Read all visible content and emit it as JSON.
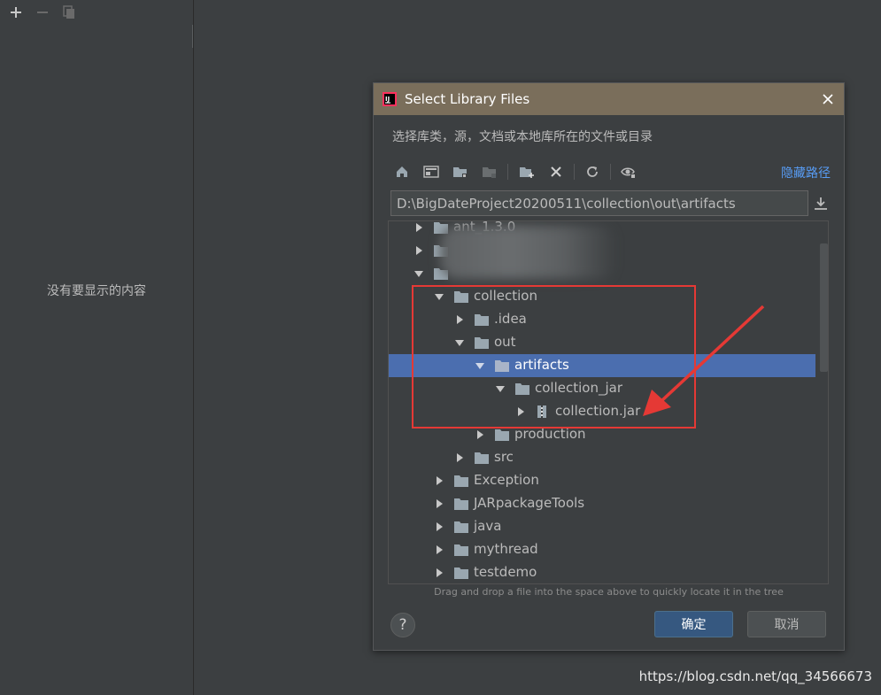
{
  "left_panel": {
    "toolbar": [
      {
        "name": "add-icon",
        "glyph": "+"
      },
      {
        "name": "remove-icon",
        "glyph": "−"
      },
      {
        "name": "copy-icon",
        "glyph": ""
      }
    ],
    "empty_text": "没有要显示的内容"
  },
  "dialog": {
    "title": "Select Library Files",
    "description": "选择库类，源，文档或本地库所在的文件或目录",
    "hide_path_link": "隐藏路径",
    "path_value": "D:\\BigDateProject20200511\\collection\\out\\artifacts",
    "hint": "Drag and drop a file into the space above to quickly locate it in the tree",
    "ok_label": "确定",
    "cancel_label": "取消",
    "help_label": "?",
    "toolbar_icons": [
      "home-icon",
      "desktop-icon",
      "project-folder-icon",
      "module-folder-icon",
      "new-folder-icon",
      "delete-icon",
      "refresh-icon",
      "show-hidden-icon"
    ]
  },
  "tree": {
    "rows": [
      {
        "label": "ant_1.3.0",
        "depth": 1,
        "expanded": false,
        "type": "folder"
      },
      {
        "label": "",
        "depth": 1,
        "expanded": false,
        "type": "folder"
      },
      {
        "label": "",
        "depth": 1,
        "expanded": true,
        "type": "folder"
      },
      {
        "label": "collection",
        "depth": 2,
        "expanded": true,
        "type": "folder"
      },
      {
        "label": ".idea",
        "depth": 3,
        "expanded": false,
        "type": "folder"
      },
      {
        "label": "out",
        "depth": 3,
        "expanded": true,
        "type": "folder"
      },
      {
        "label": "artifacts",
        "depth": 4,
        "expanded": true,
        "type": "folder",
        "selected": true
      },
      {
        "label": "collection_jar",
        "depth": 5,
        "expanded": true,
        "type": "folder"
      },
      {
        "label": "collection.jar",
        "depth": 6,
        "expanded": false,
        "type": "jar"
      },
      {
        "label": "production",
        "depth": 4,
        "expanded": false,
        "type": "folder"
      },
      {
        "label": "src",
        "depth": 3,
        "expanded": false,
        "type": "folder"
      },
      {
        "label": "Exception",
        "depth": 2,
        "expanded": false,
        "type": "folder"
      },
      {
        "label": "JARpackageTools",
        "depth": 2,
        "expanded": false,
        "type": "folder"
      },
      {
        "label": "java",
        "depth": 2,
        "expanded": false,
        "type": "folder"
      },
      {
        "label": "mythread",
        "depth": 2,
        "expanded": false,
        "type": "folder"
      },
      {
        "label": "testdemo",
        "depth": 2,
        "expanded": false,
        "type": "folder"
      }
    ]
  },
  "watermark": "https://blog.csdn.net/qq_34566673",
  "colors": {
    "selection": "#4b6eaf",
    "title_bar": "#7a6e5b",
    "annotation": "#e53935",
    "link": "#589df6"
  }
}
